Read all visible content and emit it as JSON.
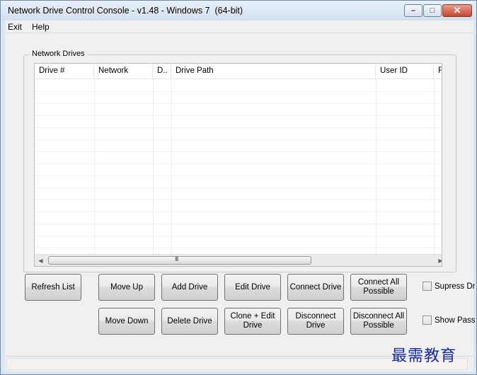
{
  "window": {
    "title": "Network Drive Control Console - v1.48 - Windows 7  (64-bit)",
    "minimize_glyph": "–",
    "maximize_glyph": "□",
    "close_glyph": "✕"
  },
  "menu": {
    "items": [
      "Exit",
      "Help"
    ]
  },
  "group": {
    "title": "Network Drives"
  },
  "table": {
    "columns": [
      "Drive #",
      "Network",
      "D..",
      "Drive Path",
      "User ID",
      "F"
    ],
    "rows": []
  },
  "scrollbar": {
    "left_arrow": "◀",
    "right_arrow": "▶",
    "grip": "III"
  },
  "buttons": {
    "refresh_list": "Refresh List",
    "move_up": "Move Up",
    "move_down": "Move Down",
    "add_drive": "Add Drive",
    "delete_drive": "Delete Drive",
    "edit_drive": "Edit Drive",
    "clone_edit_drive": "Clone + Edit Drive",
    "connect_drive": "Connect Drive",
    "disconnect_drive": "Disconnect Drive",
    "connect_all_possible": "Connect All Possible",
    "disconnect_all_possible": "Disconnect All Possible"
  },
  "checkboxes": {
    "supress_label": "Supress Dri",
    "show_pass_label": "Show Pass"
  },
  "watermark": {
    "text": "最需教育"
  }
}
